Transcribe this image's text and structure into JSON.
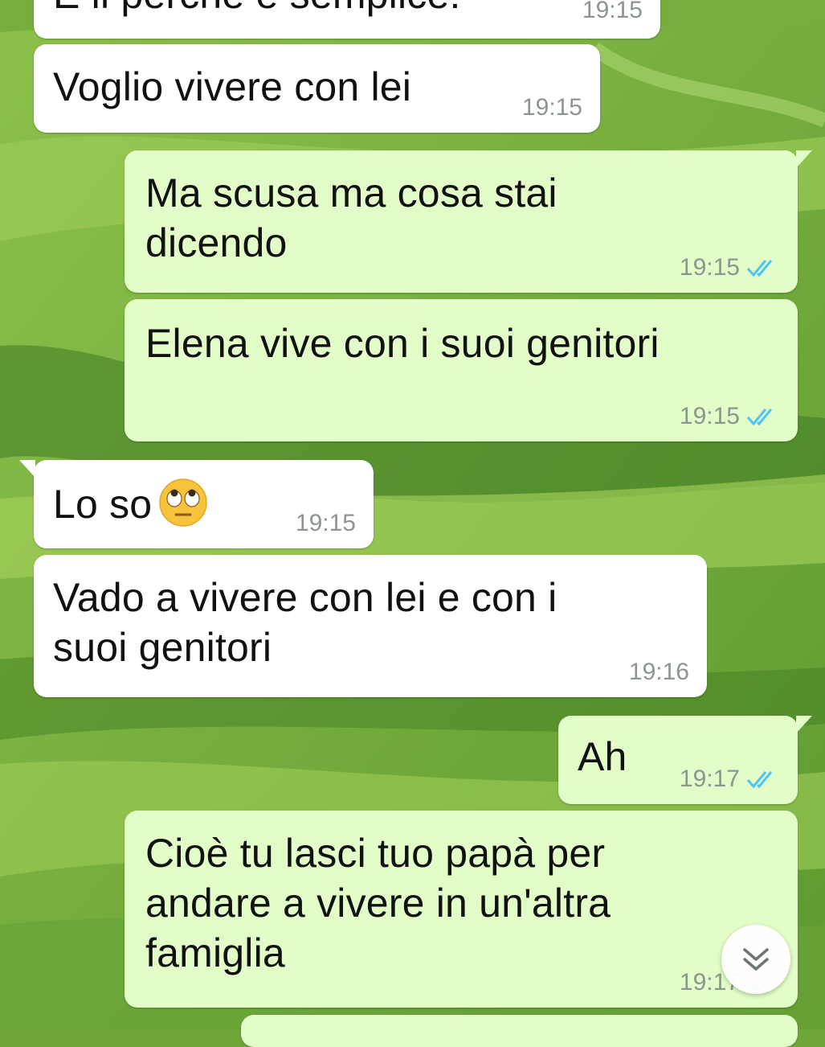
{
  "colors": {
    "incoming_bubble": "#ffffff",
    "outgoing_bubble": "#e2fdc8",
    "read_ticks": "#4fc3f7",
    "timestamp": "#8c9590"
  },
  "messages": [
    {
      "direction": "in",
      "text": "È il perché è semplice:",
      "time": "19:15"
    },
    {
      "direction": "in",
      "text": "Voglio vivere con lei",
      "time": "19:15"
    },
    {
      "direction": "out",
      "text": "Ma scusa ma cosa stai\ndicendo",
      "time": "19:15",
      "status_icon": "double-check-read-icon"
    },
    {
      "direction": "out",
      "text": "Elena vive con i suoi genitori",
      "time": "19:15",
      "status_icon": "double-check-read-icon"
    },
    {
      "direction": "in",
      "text": "Lo so",
      "emoji_icon": "face-with-rolling-eyes-icon",
      "time": "19:15"
    },
    {
      "direction": "in",
      "text": "Vado a vivere con lei e con i\nsuoi genitori",
      "time": "19:16"
    },
    {
      "direction": "out",
      "text": "Ah",
      "time": "19:17",
      "status_icon": "double-check-read-icon"
    },
    {
      "direction": "out",
      "text": "Cioè tu lasci tuo papà per\nandare a vivere in un'altra\nfamiglia",
      "time": "19:17",
      "status_icon": "double-check-read-icon"
    }
  ],
  "scroll_button": {
    "icon": "double-chevron-down-icon"
  }
}
